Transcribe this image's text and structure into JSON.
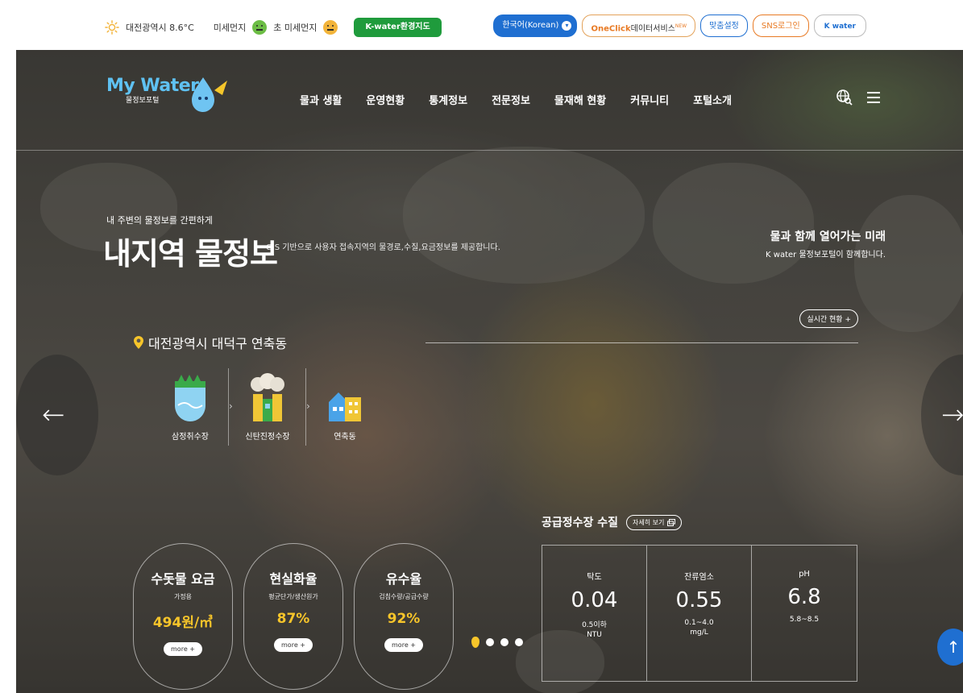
{
  "topbar": {
    "weather": "대전광역시 8.6°C",
    "fine_dust": "미세먼지",
    "ultrafine_dust": "초 미세먼지",
    "env_map": "K-water환경지도",
    "lang": "한국어(Korean)",
    "oneclick_brand": "OneClick",
    "oneclick_rest": "데이터서비스",
    "oneclick_new": "NEW",
    "custom_settings": "맞춤설정",
    "sns_login": "SNS로그인",
    "kwater": "K water"
  },
  "nav": {
    "logo_my": "My ",
    "logo_water": "Water",
    "logo_sub": "물정보포털",
    "menu": [
      "물과 생활",
      "운영현황",
      "통계정보",
      "전문정보",
      "물재해 현황",
      "커뮤니티",
      "포털소개"
    ],
    "icons": [
      "global-search-icon",
      "hamburger-menu-icon"
    ]
  },
  "hero": {
    "kicker": "내 주변의 물정보를 간편하게",
    "title": "내지역 물정보",
    "desc": "GIS 기반으로 사용자 접속지역의 물경로,수질,요금정보를 제공합니다.",
    "slogan_title": "물과 함께 열어가는 미래",
    "slogan_sub": "K water 물정보포털이 함께합니다.",
    "realtime": "실시간 현황 +"
  },
  "location": "대전광역시 대덕구 연축동",
  "facilities": [
    {
      "label": "삼정취수장",
      "icon": "intake-plant-icon"
    },
    {
      "label": "신탄진정수장",
      "icon": "purification-plant-icon"
    },
    {
      "label": "연축동",
      "icon": "residential-icon"
    }
  ],
  "stats": [
    {
      "title": "수돗물 요금",
      "sub": "가정용",
      "value": "494원/㎥",
      "more": "more +"
    },
    {
      "title": "현실화율",
      "sub": "평균단가/생산원가",
      "value": "87%",
      "more": "more +"
    },
    {
      "title": "유수율",
      "sub": "검침수량/공급수량",
      "value": "92%",
      "more": "more +"
    }
  ],
  "quality": {
    "title": "공급정수장 수질",
    "detail": "자세히 보기",
    "items": [
      {
        "name": "탁도",
        "value": "0.04",
        "range": "0.5이하",
        "unit": "NTU"
      },
      {
        "name": "잔류염소",
        "value": "0.55",
        "range": "0.1~4.0",
        "unit": "mg/L"
      },
      {
        "name": "pH",
        "value": "6.8",
        "range": "5.8~8.5",
        "unit": ""
      }
    ]
  },
  "slider": {
    "total": 4,
    "active": 1
  },
  "colors": {
    "accent_blue": "#1f6fd1",
    "accent_green": "#1f9b3c",
    "accent_orange": "#e87a24",
    "value_yellow": "#f7c52a"
  }
}
